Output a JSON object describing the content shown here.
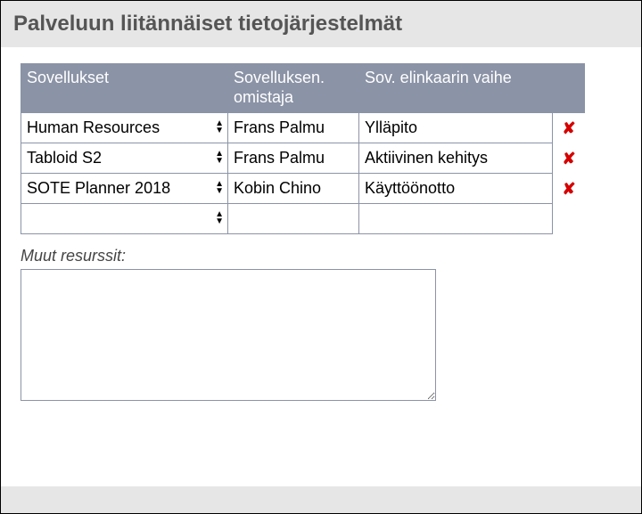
{
  "header": {
    "title": "Palveluun liitännäiset tietojärjestelmät"
  },
  "table": {
    "columns": {
      "apps": "Sovellukset",
      "owner": "Sovelluksen. omistaja",
      "phase": "Sov. elinkaarin vaihe"
    },
    "rows": [
      {
        "app": "Human Resources",
        "owner": "Frans Palmu",
        "phase": "Ylläpito"
      },
      {
        "app": "Tabloid S2",
        "owner": "Frans Palmu",
        "phase": "Aktiivinen kehitys"
      },
      {
        "app": "SOTE Planner 2018",
        "owner": "Kobin Chino",
        "phase": "Käyttöönotto"
      },
      {
        "app": "",
        "owner": "",
        "phase": ""
      }
    ]
  },
  "other": {
    "label": "Muut resurssit:",
    "value": ""
  },
  "icons": {
    "delete": "✘"
  }
}
